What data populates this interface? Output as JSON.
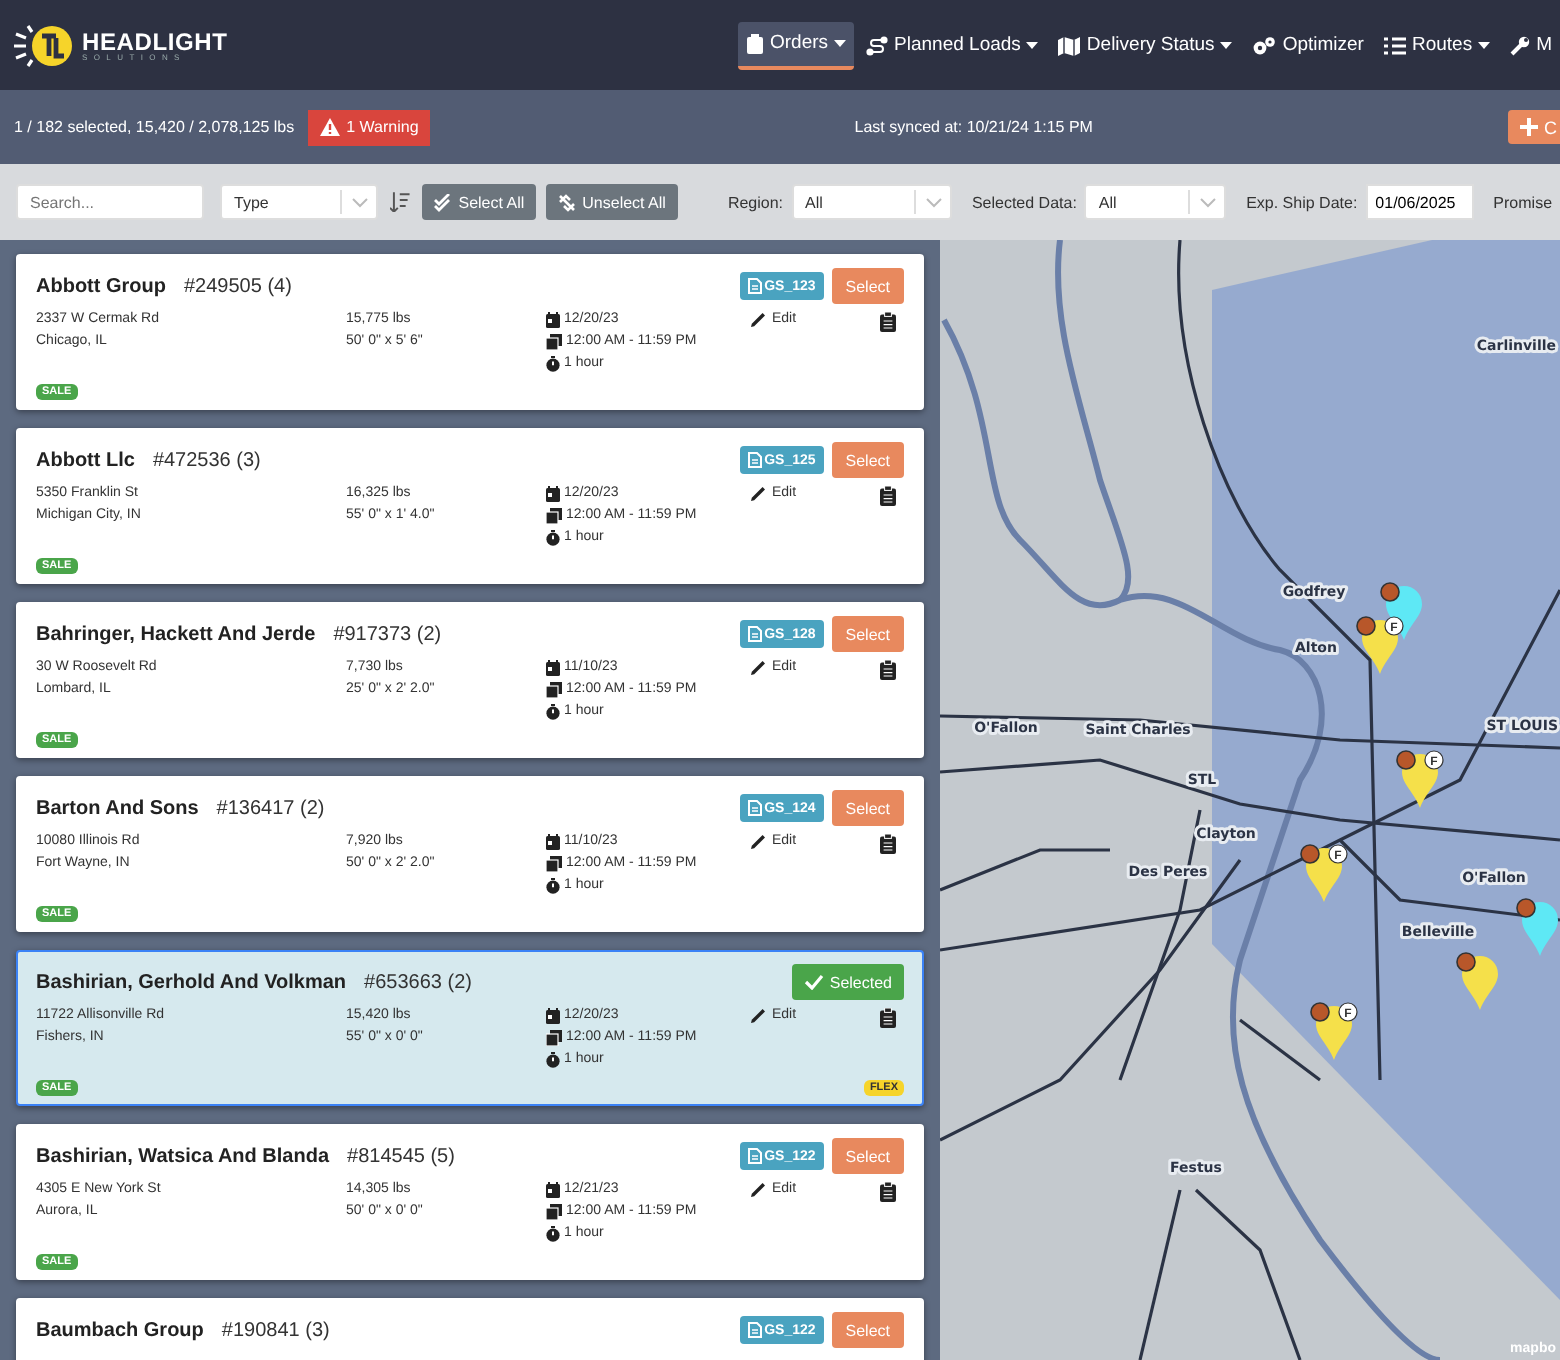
{
  "brand": {
    "name": "HEADLIGHT",
    "tagline": "SOLUTIONS"
  },
  "nav": [
    {
      "label": "Orders",
      "dropdown": true,
      "selected": true
    },
    {
      "label": "Planned Loads",
      "dropdown": true,
      "selected": false
    },
    {
      "label": "Delivery Status",
      "dropdown": true,
      "selected": false
    },
    {
      "label": "Optimizer",
      "dropdown": false,
      "selected": false
    },
    {
      "label": "Routes",
      "dropdown": true,
      "selected": false
    },
    {
      "label": "M",
      "dropdown": false,
      "selected": false
    }
  ],
  "status_bar": {
    "summary": "1 / 182 selected, 15,420 / 2,078,125 lbs",
    "warning": "1 Warning",
    "synced": "Last synced at: 10/21/24 1:15 PM",
    "create_button": "C"
  },
  "filters": {
    "search": {
      "placeholder": "Search..."
    },
    "type": {
      "value": "Type"
    },
    "select_all": "Select All",
    "unselect_all": "Unselect All",
    "region": {
      "label": "Region:",
      "value": "All"
    },
    "selected_data": {
      "label": "Selected Data:",
      "value": "All"
    },
    "ship_date": {
      "label": "Exp. Ship Date:",
      "value": "01/06/2025"
    },
    "promise": {
      "label": "Promise"
    }
  },
  "orders": [
    {
      "name": "Abbott Group",
      "number": "#249505 (4)",
      "address": "2337 W Cermak Rd",
      "city": "Chicago, IL",
      "weight": "15,775 lbs",
      "dims": "50' 0\" x 5' 6\"",
      "date": "12/20/23",
      "window": "12:00 AM - 11:59 PM",
      "duration": "1 hour",
      "edit": "Edit",
      "doc": "GS_123",
      "button": "Select",
      "selected": false,
      "tags": [
        {
          "label": "SALE",
          "kind": "sale"
        }
      ]
    },
    {
      "name": "Abbott Llc",
      "number": "#472536 (3)",
      "address": "5350 Franklin St",
      "city": "Michigan City, IN",
      "weight": "16,325 lbs",
      "dims": "55' 0\" x 1' 4.0\"",
      "date": "12/20/23",
      "window": "12:00 AM - 11:59 PM",
      "duration": "1 hour",
      "edit": "Edit",
      "doc": "GS_125",
      "button": "Select",
      "selected": false,
      "tags": [
        {
          "label": "SALE",
          "kind": "sale"
        }
      ]
    },
    {
      "name": "Bahringer, Hackett And Jerde",
      "number": "#917373 (2)",
      "address": "30 W Roosevelt Rd",
      "city": "Lombard, IL",
      "weight": "7,730 lbs",
      "dims": "25' 0\" x 2' 2.0\"",
      "date": "11/10/23",
      "window": "12:00 AM - 11:59 PM",
      "duration": "1 hour",
      "edit": "Edit",
      "doc": "GS_128",
      "button": "Select",
      "selected": false,
      "tags": [
        {
          "label": "SALE",
          "kind": "sale"
        }
      ]
    },
    {
      "name": "Barton And Sons",
      "number": "#136417 (2)",
      "address": "10080 Illinois Rd",
      "city": "Fort Wayne, IN",
      "weight": "7,920 lbs",
      "dims": "50' 0\" x 2' 2.0\"",
      "date": "11/10/23",
      "window": "12:00 AM - 11:59 PM",
      "duration": "1 hour",
      "edit": "Edit",
      "doc": "GS_124",
      "button": "Select",
      "selected": false,
      "tags": [
        {
          "label": "SALE",
          "kind": "sale"
        }
      ]
    },
    {
      "name": "Bashirian, Gerhold And Volkman",
      "number": "#653663 (2)",
      "address": "11722 Allisonville Rd",
      "city": "Fishers, IN",
      "weight": "15,420 lbs",
      "dims": "55' 0\" x 0' 0\"",
      "date": "12/20/23",
      "window": "12:00 AM - 11:59 PM",
      "duration": "1 hour",
      "edit": "Edit",
      "button": "Selected",
      "selected": true,
      "tags": [
        {
          "label": "SALE",
          "kind": "sale"
        },
        {
          "label": "FLEX",
          "kind": "flex"
        }
      ]
    },
    {
      "name": "Bashirian, Watsica And Blanda",
      "number": "#814545 (5)",
      "address": "4305 E New York St",
      "city": "Aurora, IL",
      "weight": "14,305 lbs",
      "dims": "50' 0\" x 0' 0\"",
      "date": "12/21/23",
      "window": "12:00 AM - 11:59 PM",
      "duration": "1 hour",
      "edit": "Edit",
      "doc": "GS_122",
      "button": "Select",
      "selected": false,
      "tags": [
        {
          "label": "SALE",
          "kind": "sale"
        }
      ]
    },
    {
      "name": "Baumbach Group",
      "number": "#190841 (3)",
      "doc": "GS_122",
      "button": "Select",
      "selected": false
    }
  ],
  "map": {
    "places": [
      "Carlinville",
      "Godfrey",
      "Alton",
      "O'Fallon",
      "Saint Charles",
      "STL",
      "ST LOUIS",
      "Clayton",
      "Des Peres",
      "O'Fallon",
      "Belleville",
      "Festus"
    ],
    "pins": [
      {
        "color": "#5ee8f5"
      },
      {
        "color": "#f5e04a",
        "flag": "F"
      },
      {
        "color": "#f5e04a",
        "flag": "F"
      },
      {
        "color": "#f5e04a",
        "flag": "F"
      },
      {
        "color": "#5ee8f5"
      },
      {
        "color": "#f5e04a"
      },
      {
        "color": "#f5e04a",
        "flag": "F"
      }
    ],
    "attribution": "mapbo"
  }
}
